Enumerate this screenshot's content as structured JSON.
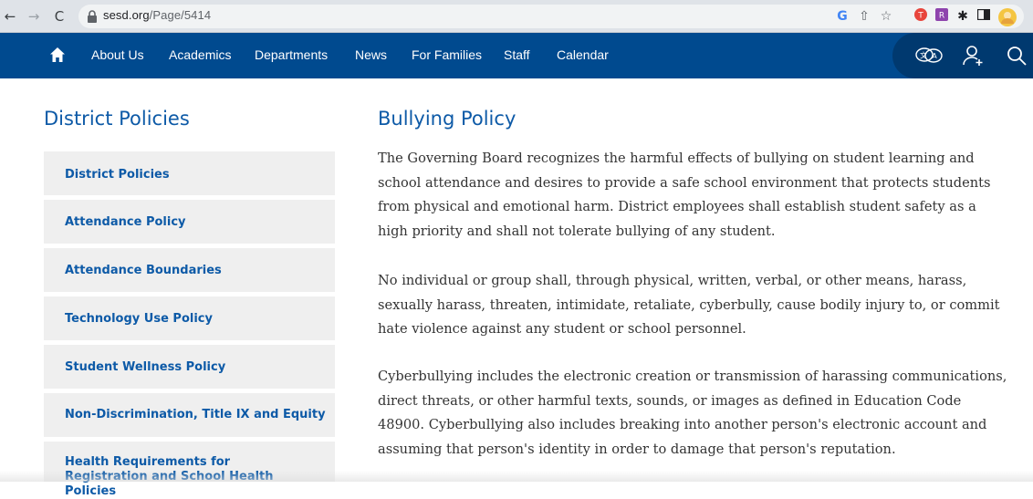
{
  "browser": {
    "url_host": "sesd.org",
    "url_path": "/Page/5414",
    "back_icon": "arrow-left-icon",
    "forward_icon": "arrow-right-icon",
    "reload_icon": "reload-icon"
  },
  "nav": {
    "items": [
      {
        "label": "About Us"
      },
      {
        "label": "Academics"
      },
      {
        "label": "Departments"
      },
      {
        "label": "News"
      },
      {
        "label": "For Families"
      },
      {
        "label": "Staff"
      },
      {
        "label": "Calendar"
      }
    ],
    "colors": {
      "bar": "#004a8f",
      "right_panel": "#00396f"
    }
  },
  "sidebar": {
    "title": "District Policies",
    "items": [
      {
        "label": "District Policies"
      },
      {
        "label": "Attendance Policy"
      },
      {
        "label": "Attendance Boundaries"
      },
      {
        "label": "Technology Use Policy"
      },
      {
        "label": "Student Wellness Policy"
      },
      {
        "label": "Non-Discrimination, Title IX and Equity"
      },
      {
        "label": "Health Requirements for Registration and School Health Policies"
      }
    ]
  },
  "main": {
    "title": "Bullying Policy",
    "paragraphs": [
      "The Governing Board recognizes the harmful effects of bullying on student learning and school attendance and desires to provide a safe school environment that protects students from physical and emotional harm. District employees shall establish student safety as a high priority and shall not tolerate bullying of any student.",
      "No individual or group shall, through physical, written, verbal, or other means, harass, sexually harass, threaten, intimidate, retaliate, cyberbully, cause bodily injury to, or commit hate violence against any student or school personnel.",
      "Cyberbullying includes the electronic creation or transmission of harassing communications, direct threats, or other harmful texts, sounds, or images as defined in Education Code 48900. Cyberbullying also includes breaking into another person's electronic account and assuming that person's identity in order to damage that person's reputation."
    ]
  }
}
